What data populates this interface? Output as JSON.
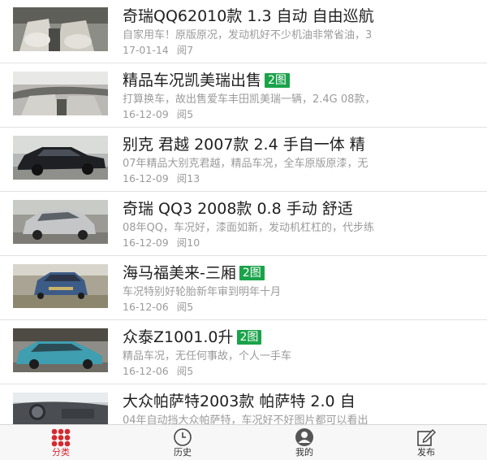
{
  "listings": [
    {
      "title": "奇瑞QQ62010款 1.3 自动 自由巡航",
      "badge": "",
      "desc": "自家用车！原版原况，发动机好不少机油非常省油，3",
      "date": "17-01-14",
      "views": "阅7",
      "image_icon": "car-interior-photo"
    },
    {
      "title": "精品车况凯美瑞出售",
      "badge": "2图",
      "desc": "打算换车，故出售爱车丰田凯美瑞一辆，2.4G 08款，",
      "date": "16-12-09",
      "views": "阅5",
      "image_icon": "car-interior-photo"
    },
    {
      "title": "别克 君越 2007款 2.4 手自一体 精",
      "badge": "",
      "desc": "07年精品大别克君越，精品车况，全车原版原漆，无",
      "date": "16-12-09",
      "views": "阅13",
      "image_icon": "black-sedan-photo"
    },
    {
      "title": "奇瑞 QQ3 2008款 0.8 手动 舒适",
      "badge": "",
      "desc": "08年QQ，车况好，漆面如新，发动机杠杠的，代步练",
      "date": "16-12-09",
      "views": "阅10",
      "image_icon": "silver-hatchback-photo"
    },
    {
      "title": "海马福美来-三厢",
      "badge": "2图",
      "desc": "车况特别好轮胎新年审到明年十月",
      "date": "16-12-06",
      "views": "阅5",
      "image_icon": "blue-sedan-photo"
    },
    {
      "title": "众泰Z1001.0升",
      "badge": "2图",
      "desc": "精品车况，无任何事故，个人一手车",
      "date": "16-12-06",
      "views": "阅5",
      "image_icon": "teal-hatchback-photo"
    },
    {
      "title": "大众帕萨特2003款 帕萨特 2.0 自",
      "badge": "",
      "desc": "04年自动挡大众帕萨特，车况好不好图片都可以看出",
      "date": "",
      "views": "",
      "image_icon": "dashboard-photo"
    }
  ],
  "tabbar": {
    "tabs": [
      {
        "label": "分类",
        "icon": "grid-dots-icon",
        "active": true
      },
      {
        "label": "历史",
        "icon": "clock-icon",
        "active": false
      },
      {
        "label": "我的",
        "icon": "user-icon",
        "active": false
      },
      {
        "label": "发布",
        "icon": "edit-icon",
        "active": false
      }
    ],
    "active_color": "#d7282f",
    "badge_color": "#1aa34a"
  }
}
